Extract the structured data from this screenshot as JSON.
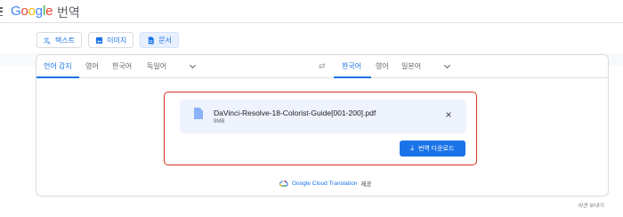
{
  "header": {
    "logo": {
      "G": "G",
      "o1": "o",
      "o2": "o",
      "g": "g",
      "l": "l",
      "e": "e"
    },
    "title": "번역"
  },
  "modes": [
    {
      "label": "텍스트",
      "icon": "translate-icon"
    },
    {
      "label": "이미지",
      "icon": "image-icon"
    },
    {
      "label": "문서",
      "icon": "document-icon"
    }
  ],
  "source_langs": [
    {
      "label": "언어 감지"
    },
    {
      "label": "영어"
    },
    {
      "label": "한국어"
    },
    {
      "label": "독일어"
    }
  ],
  "target_langs": [
    {
      "label": "한국어"
    },
    {
      "label": "영어"
    },
    {
      "label": "일본어"
    }
  ],
  "file": {
    "name": "DaVinci-Resolve-18-Colorist-Guide[001-200].pdf",
    "size": "9MB"
  },
  "download_label": "번역 다운로드",
  "attribution": {
    "link": "Google Cloud Translation",
    "suffix": "제공"
  },
  "feedback": "의견 보내기",
  "colors": {
    "accent": "#1a73e8",
    "highlight": "#d93025",
    "file_bg": "#eef3fd"
  }
}
